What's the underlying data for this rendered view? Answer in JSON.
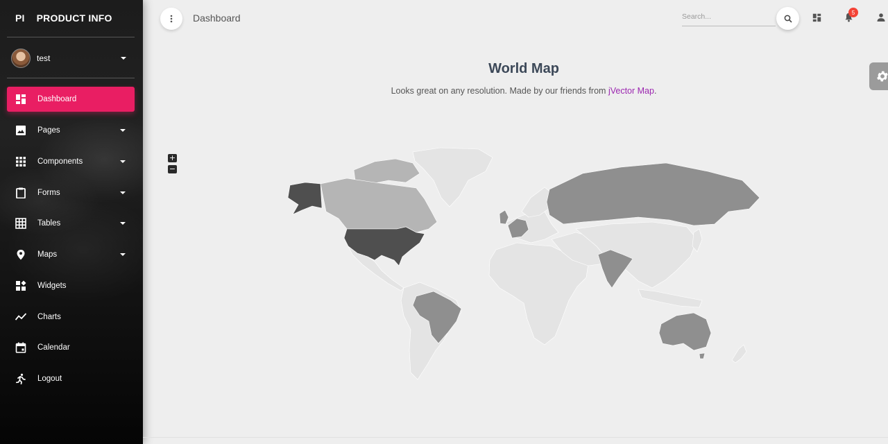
{
  "brand": {
    "short": "PI",
    "name": "PRODUCT INFO"
  },
  "user": {
    "name": "test"
  },
  "nav": {
    "dashboard": "Dashboard",
    "pages": "Pages",
    "components": "Components",
    "forms": "Forms",
    "tables": "Tables",
    "maps": "Maps",
    "widgets": "Widgets",
    "charts": "Charts",
    "calendar": "Calendar",
    "logout": "Logout"
  },
  "header": {
    "breadcrumb": "Dashboard",
    "search_placeholder": "Search...",
    "notification_count": "5"
  },
  "content": {
    "title": "World Map",
    "subtitle_prefix": "Looks great on any resolution. Made by our friends from ",
    "subtitle_link": "jVector Map",
    "subtitle_suffix": "."
  },
  "map_controls": {
    "zoom_in": "+",
    "zoom_out": "−"
  },
  "colors": {
    "accent": "#e91e63",
    "link": "#9c27b0",
    "badge": "#f44336",
    "map_base": "#e4e4e4",
    "map_high": "#4f4f4f",
    "map_mid": "#8f8f8f",
    "map_low": "#b5b5b5"
  },
  "map_highlights": [
    {
      "region": "United States",
      "level": "high"
    },
    {
      "region": "Alaska",
      "level": "high"
    },
    {
      "region": "Canada",
      "level": "low"
    },
    {
      "region": "Brazil",
      "level": "mid"
    },
    {
      "region": "Russia",
      "level": "mid"
    },
    {
      "region": "India",
      "level": "mid"
    },
    {
      "region": "Australia",
      "level": "mid"
    },
    {
      "region": "United Kingdom",
      "level": "mid"
    },
    {
      "region": "Germany",
      "level": "mid"
    }
  ]
}
